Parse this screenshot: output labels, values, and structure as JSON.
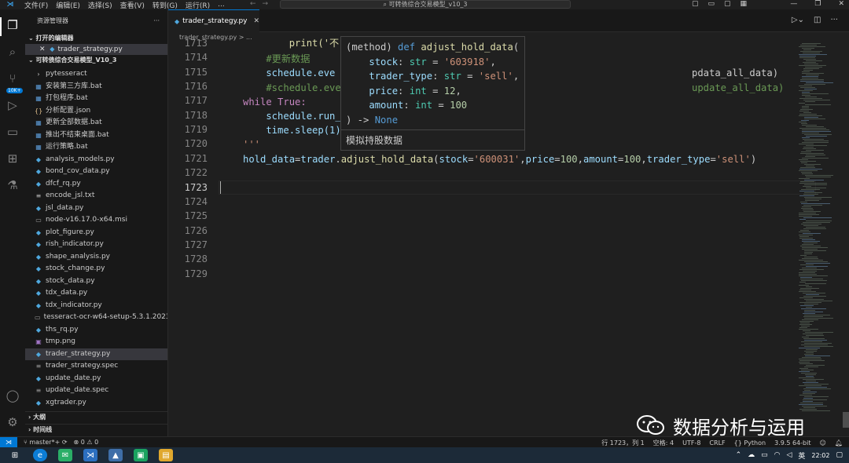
{
  "titlebar": {
    "menus": [
      "文件(F)",
      "编辑(E)",
      "选择(S)",
      "查看(V)",
      "转到(G)",
      "运行(R)",
      "..."
    ],
    "search": "可转债综合交易模型_v10_3"
  },
  "sidebar": {
    "header": "资源管理器",
    "open_editors_label": "打开的编辑器",
    "open_editor_file": "trader_strategy.py",
    "project_label": "可转债综合交易模型_V10_3",
    "files": [
      {
        "name": "pytesseract",
        "icon": "chevron-right-icon"
      },
      {
        "name": "安装第三方库.bat",
        "icon": "bat-file-icon"
      },
      {
        "name": "打包程序.bat",
        "icon": "bat-file-icon"
      },
      {
        "name": "分析配置.json",
        "icon": "json-file-icon"
      },
      {
        "name": "更新全部数据.bat",
        "icon": "bat-file-icon"
      },
      {
        "name": "推出不结束桌面.bat",
        "icon": "bat-file-icon"
      },
      {
        "name": "运行策略.bat",
        "icon": "bat-file-icon"
      },
      {
        "name": "analysis_models.py",
        "icon": "python-file-icon"
      },
      {
        "name": "bond_cov_data.py",
        "icon": "python-file-icon"
      },
      {
        "name": "dfcf_rq.py",
        "icon": "python-file-icon"
      },
      {
        "name": "encode_jsl.txt",
        "icon": "text-file-icon"
      },
      {
        "name": "jsl_data.py",
        "icon": "python-file-icon"
      },
      {
        "name": "node-v16.17.0-x64.msi",
        "icon": "msi-file-icon"
      },
      {
        "name": "plot_figure.py",
        "icon": "python-file-icon"
      },
      {
        "name": "rish_indicator.py",
        "icon": "python-file-icon"
      },
      {
        "name": "shape_analysis.py",
        "icon": "python-file-icon"
      },
      {
        "name": "stock_change.py",
        "icon": "python-file-icon"
      },
      {
        "name": "stock_data.py",
        "icon": "python-file-icon"
      },
      {
        "name": "tdx_data.py",
        "icon": "python-file-icon"
      },
      {
        "name": "tdx_indicator.py",
        "icon": "python-file-icon"
      },
      {
        "name": "tesseract-ocr-w64-setup-5.3.1.20230...",
        "icon": "exe-file-icon"
      },
      {
        "name": "ths_rq.py",
        "icon": "python-file-icon"
      },
      {
        "name": "tmp.png",
        "icon": "image-file-icon"
      },
      {
        "name": "trader_strategy.py",
        "icon": "python-file-icon"
      },
      {
        "name": "trader_strategy.spec",
        "icon": "spec-file-icon"
      },
      {
        "name": "update_date.py",
        "icon": "python-file-icon"
      },
      {
        "name": "update_date.spec",
        "icon": "spec-file-icon"
      },
      {
        "name": "xgtrader.py",
        "icon": "python-file-icon"
      }
    ],
    "outline_label": "大纲",
    "timeline_label": "时间线"
  },
  "tab": {
    "label": "trader_strategy.py",
    "breadcrumb": "trader_strategy.py > ..."
  },
  "editor": {
    "line_numbers": [
      "1713",
      "1714",
      "1715",
      "1716",
      "1717",
      "1718",
      "1719",
      "1720",
      "1721",
      "1722",
      "1723",
      "1724",
      "1725",
      "1726",
      "1727",
      "1728",
      "1729"
    ],
    "current_line": "1723",
    "code": {
      "l1713": "        print('不...",
      "l1714": "    #更新数据",
      "l1715_a": "    schedule.eve",
      "l1715_b": "pdata_all_data)",
      "l1716_a": "    #schedule.eve",
      "l1716_b": "update_all_data)",
      "l1717": "while True:",
      "l1718": "    schedule.run_",
      "l1719": "    time.sleep(1)",
      "l1720": "'''",
      "l1721_var": "hold_data",
      "l1721_obj": "trader",
      "l1721_fn": "adjust_hold_data",
      "l1721_k1": "stock",
      "l1721_v1": "'600031'",
      "l1721_k2": "price",
      "l1721_v2": "100",
      "l1721_k3": "amount",
      "l1721_v3": "100",
      "l1721_k4": "trader_type",
      "l1721_v4": "'sell'"
    }
  },
  "hover": {
    "kind": "(method)",
    "def": "def",
    "name": "adjust_hold_data",
    "params": [
      {
        "name": "stock",
        "type": "str",
        "default": "'603918'"
      },
      {
        "name": "trader_type",
        "type": "str",
        "default": "'sell'"
      },
      {
        "name": "price",
        "type": "int",
        "default": "12"
      },
      {
        "name": "amount",
        "type": "int",
        "default": "100"
      }
    ],
    "returns": "None",
    "doc": "模拟持股数据"
  },
  "watermark": "数据分析与运用",
  "statusbar": {
    "branch": "master*+",
    "errors": "0",
    "warnings": "0",
    "position": "行 1723，列 1",
    "spaces": "空格: 4",
    "encoding": "UTF-8",
    "eol": "CRLF",
    "language": "Python",
    "interpreter": "3.9.5 64-bit"
  },
  "taskbar": {
    "time": "22:02",
    "ime": "英"
  },
  "colors": {
    "accent": "#0078d4",
    "keyword": "#569cd6",
    "string": "#ce9178",
    "number": "#b5cea8",
    "comment": "#6a9955",
    "function": "#dcdcaa"
  }
}
